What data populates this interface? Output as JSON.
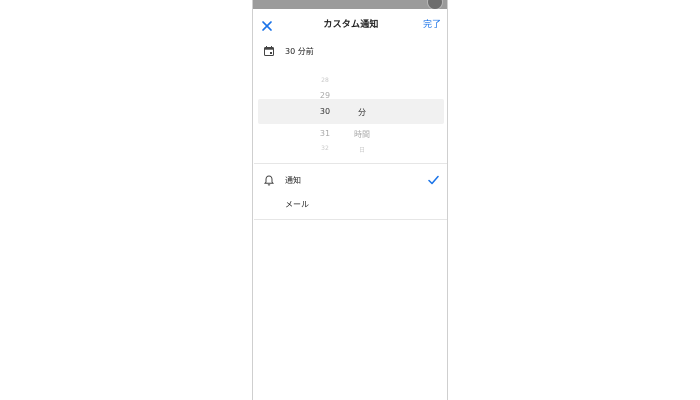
{
  "header": {
    "title": "カスタム通知",
    "done_label": "完了"
  },
  "reminder": {
    "summary": "30 分前"
  },
  "picker": {
    "numbers": [
      "28",
      "29",
      "30",
      "31",
      "32"
    ],
    "units": [
      "分",
      "時間",
      "日"
    ],
    "selected_number": "30",
    "selected_unit": "分"
  },
  "methods": {
    "notification_label": "通知",
    "email_label": "メール",
    "selected": "通知"
  },
  "colors": {
    "accent": "#1a73e8",
    "band": "#f1f1f1",
    "text": "#222222"
  },
  "icons": [
    "close-icon",
    "calendar-icon",
    "bell-icon",
    "check-icon"
  ]
}
